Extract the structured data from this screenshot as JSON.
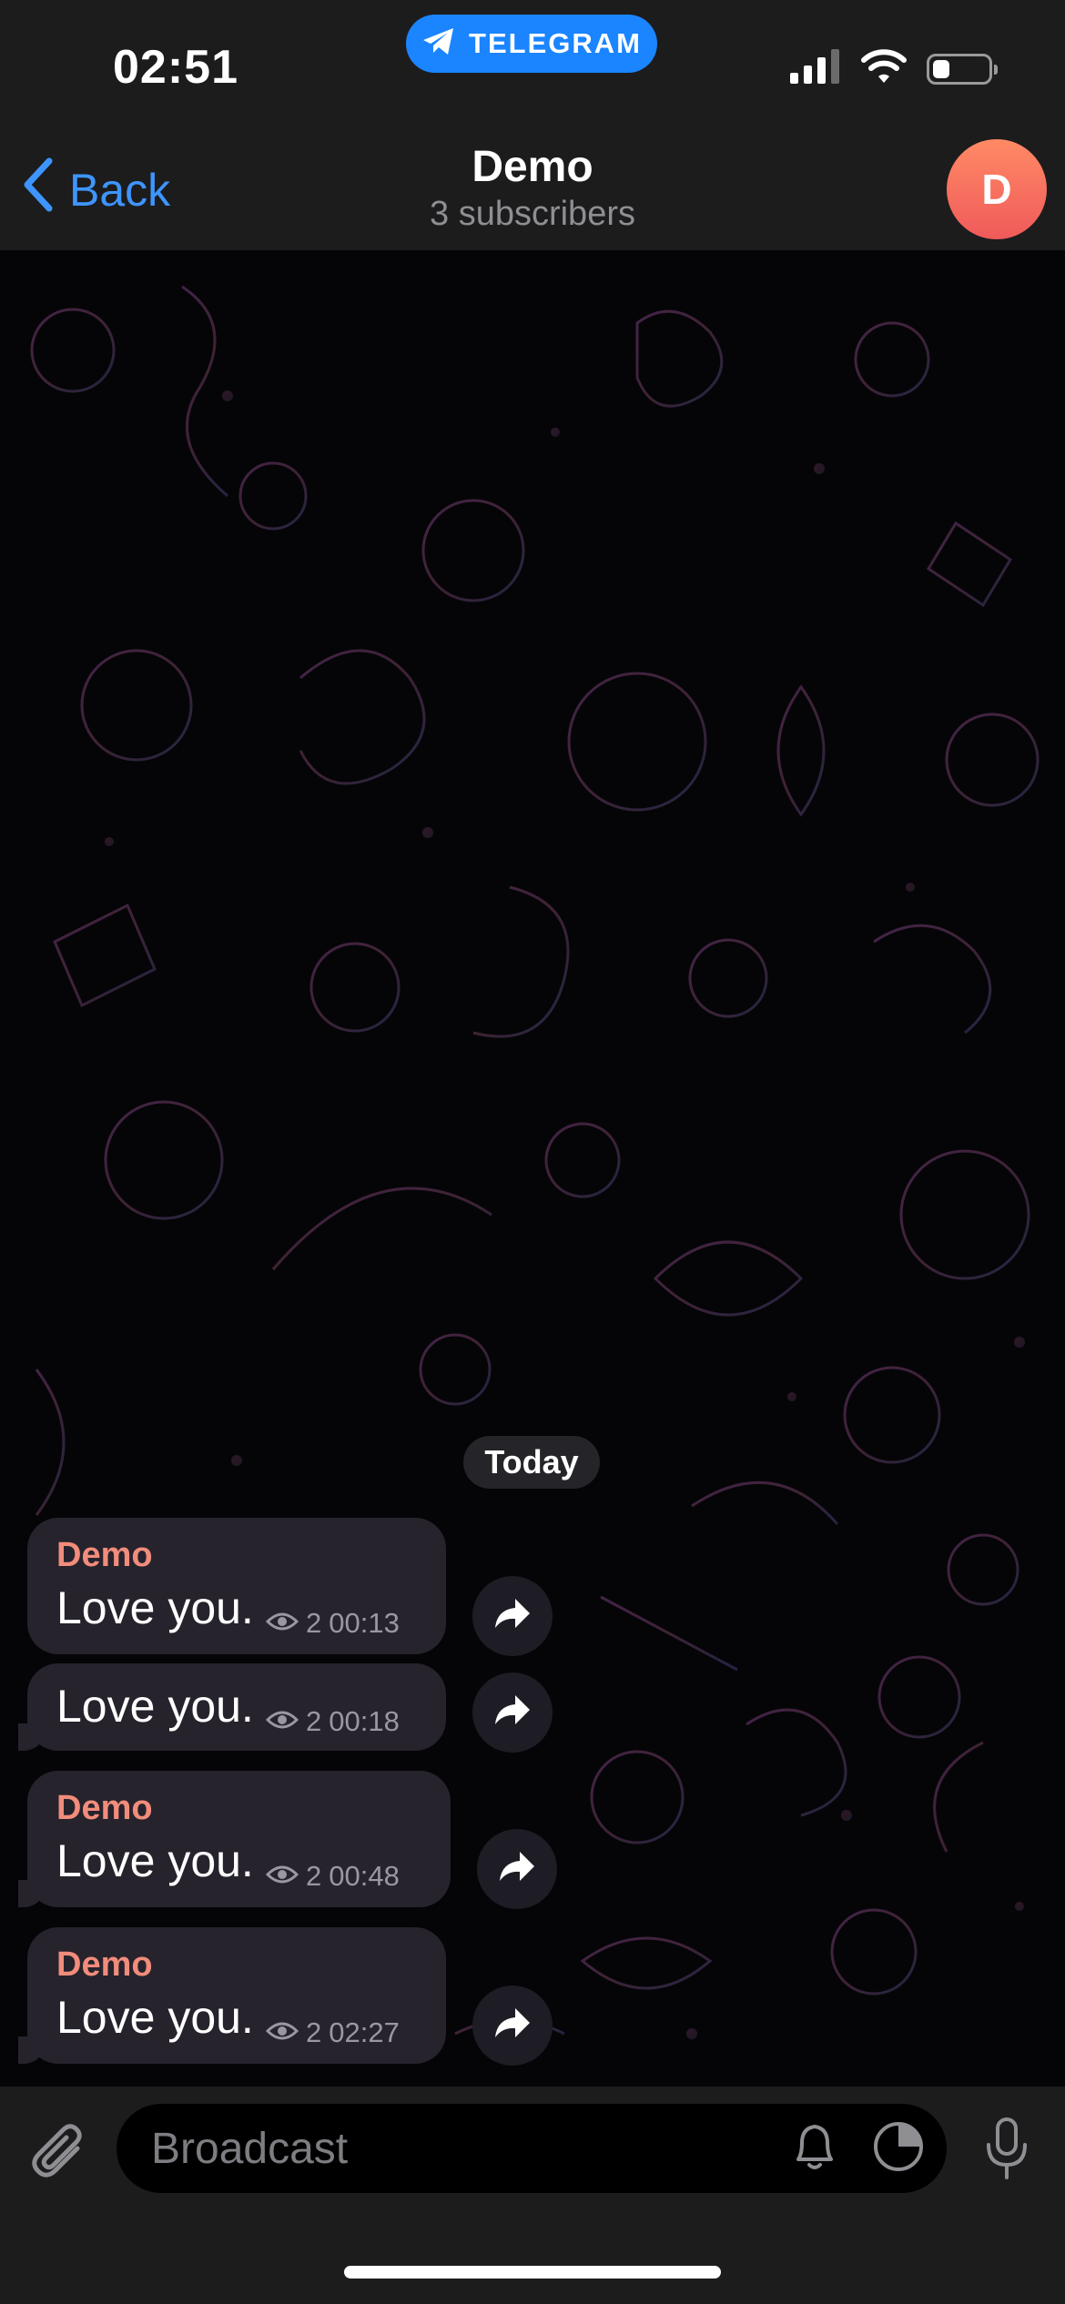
{
  "status_bar": {
    "time": "02:51",
    "app_pill": "TELEGRAM"
  },
  "header": {
    "back_label": "Back",
    "title": "Demo",
    "subtitle": "3 subscribers",
    "avatar_initial": "D"
  },
  "date_separator": "Today",
  "messages": [
    {
      "sender": "Demo",
      "text": "Love you.",
      "views": "2",
      "time": "00:13"
    },
    {
      "sender": "",
      "text": "Love you.",
      "views": "2",
      "time": "00:18"
    },
    {
      "sender": "Demo",
      "text": "Love you.",
      "views": "2",
      "time": "00:48"
    },
    {
      "sender": "Demo",
      "text": "Love you.",
      "views": "2",
      "time": "02:27"
    }
  ],
  "composer": {
    "placeholder": "Broadcast"
  },
  "colors": {
    "accent": "#3e95ff",
    "telegram_pill": "#1a85ff",
    "sender_name": "#f28c7b",
    "bubble": "#26232d"
  },
  "icons": [
    "telegram-plane-icon",
    "signal-icon",
    "wifi-icon",
    "battery-icon",
    "chevron-left-icon",
    "eye-icon",
    "share-arrow-icon",
    "paperclip-icon",
    "bell-icon",
    "timer-icon",
    "microphone-icon"
  ]
}
